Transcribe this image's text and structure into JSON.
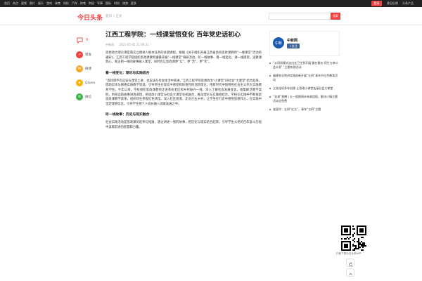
{
  "topbar": {
    "nav": [
      "首页",
      "热点",
      "视频",
      "图片",
      "娱乐",
      "游戏",
      "体育",
      "科技",
      "汽车",
      "体育",
      "财经",
      "军事",
      "国际",
      "时尚",
      "旅游",
      "更多"
    ],
    "login": "登录",
    "feedback": "意见反馈",
    "investor": "头条产品"
  },
  "header": {
    "logo": "今日头条",
    "breadcrumb": [
      "首页",
      "正文"
    ],
    "search_placeholder": "",
    "search_button": "搜索"
  },
  "share": {
    "comment_count": "0",
    "items": [
      {
        "label": "转发",
        "color": "#f04142",
        "glyph": "↗"
      },
      {
        "label": "微博",
        "color": "#f5a623",
        "glyph": "W"
      },
      {
        "label": "Qzone",
        "color": "#ffb300",
        "glyph": "★"
      },
      {
        "label": "微信",
        "color": "#3db44a",
        "glyph": "✆"
      }
    ]
  },
  "article": {
    "title": "江西工程学院：一线课堂悟变化 百年党史话初心",
    "source": "中新网",
    "time": "2021-05-05 21:06:31",
    "p1": "思想政治理论课是落实立德树人根本任务的关键课程。根据《关于组织开展江西省高校思政课教师“一线课堂”活动的通知》，江西工程学院组织思政课教师遵循开展“一线课堂”调研活动，听一线故事、看一线变化、讲一线感受，送教课到心，真正把一线的故事融入课堂，同时也让思政课更“实”、更“活”、更“亲”。",
    "h1": "看一线变化：理论与实践结合",
    "p2": "“思政课不仅应该在课堂上讲，也应该在社会生活中来讲。”江西工程学院思想政治“小课堂”同社会“大课堂”结合起来，借助实体与网络实践教学资源，引导师生在现实中感受和体悟党的创新理论，用新时代中国特色社会主义伟大实践教育学生。今年以来，学校组织思政课教师走进革命老区和乡村振兴一线，深入了解社会发展变化，收集鲜活教学案例，用身边的故事讲清道理，把思政小课堂与社会大课堂有机融合，推动理论与实践相结合。学校在实践中不断探索思政课教学改革，组织师生参观红色场馆、深入社区街道、走访企业乡村，让学生在行走中感悟思想伟力，在实践中坚定理想信念，引导学生把个人成长融入国家发展之中。",
    "h2": "听一线故事：历史与现实融合",
    "p3": "社会实践活动是思政课的延伸与拓展，通过讲述一线的故事，把历史与现实结合起来，引导学生从党的百年奋斗历程中汲取前进的智慧和力量。"
  },
  "aside": {
    "author_name": "中新网",
    "avatar_text": "中新",
    "follow": "+关注",
    "related": [
      "“从同质模式走出去卫生到开展‘委在看在·同生与参众会众奖’ ”主题实践活动",
      "福建农业院讲实践创新开展“五四”青年节红色教育活动",
      "江苏连续多年创建 让思政小课堂连接社会大课堂",
      "“花漾”直播 | 五一假期周末有高回报，解决小镇主题活动全免费",
      "张国华：五四“红五”，青年“五四”主题"
    ],
    "qr_caption": "扫码下载今日头条APP"
  }
}
